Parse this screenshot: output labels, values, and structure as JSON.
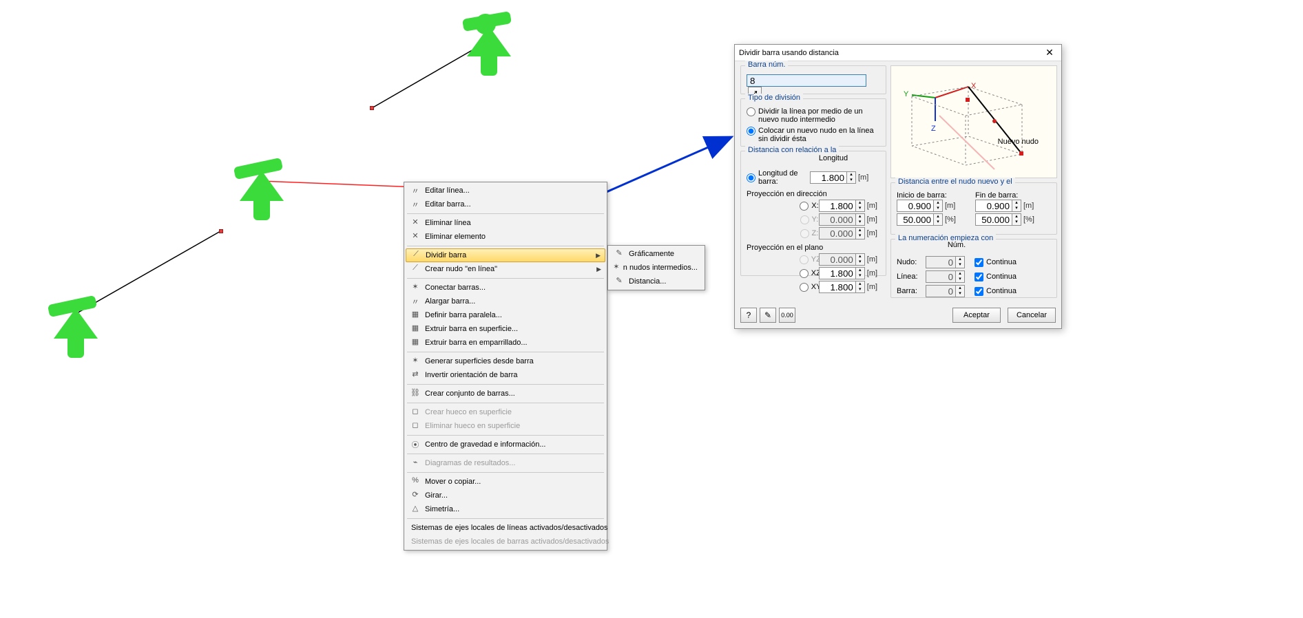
{
  "context_menu": {
    "items": [
      {
        "label": "Editar línea...",
        "sub": false,
        "disabled": false,
        "icon": "〃"
      },
      {
        "label": "Editar barra...",
        "sub": false,
        "disabled": false,
        "icon": "〃"
      },
      {
        "sep": true
      },
      {
        "label": "Eliminar línea",
        "sub": false,
        "disabled": false,
        "icon": "✕"
      },
      {
        "label": "Eliminar elemento",
        "sub": false,
        "disabled": false,
        "icon": "✕"
      },
      {
        "sep": true
      },
      {
        "label": "Dividir barra",
        "sub": true,
        "disabled": false,
        "highlight": true,
        "icon": "⟋"
      },
      {
        "label": "Crear nudo \"en línea\"",
        "sub": true,
        "disabled": false,
        "icon": "⟋"
      },
      {
        "sep": true
      },
      {
        "label": "Conectar barras...",
        "sub": false,
        "disabled": false,
        "icon": "✶"
      },
      {
        "label": "Alargar barra...",
        "sub": false,
        "disabled": false,
        "icon": "〃"
      },
      {
        "label": "Definir barra paralela...",
        "sub": false,
        "disabled": false,
        "icon": "▦"
      },
      {
        "label": "Extruir barra en superficie...",
        "sub": false,
        "disabled": false,
        "icon": "▦"
      },
      {
        "label": "Extruir barra en emparrillado...",
        "sub": false,
        "disabled": false,
        "icon": "▦"
      },
      {
        "sep": true
      },
      {
        "label": "Generar superficies desde barra",
        "sub": false,
        "disabled": false,
        "icon": "✶"
      },
      {
        "label": "Invertir orientación de barra",
        "sub": false,
        "disabled": false,
        "icon": "⇄"
      },
      {
        "sep": true
      },
      {
        "label": "Crear conjunto de barras...",
        "sub": false,
        "disabled": false,
        "icon": "⛓"
      },
      {
        "sep": true
      },
      {
        "label": "Crear hueco en superficie",
        "sub": false,
        "disabled": true,
        "icon": "◻"
      },
      {
        "label": "Eliminar hueco en superficie",
        "sub": false,
        "disabled": true,
        "icon": "◻"
      },
      {
        "sep": true
      },
      {
        "label": "Centro de gravedad e información...",
        "sub": false,
        "disabled": false,
        "icon": "⦿"
      },
      {
        "sep": true
      },
      {
        "label": "Diagramas de resultados...",
        "sub": false,
        "disabled": true,
        "icon": "⌁"
      },
      {
        "sep": true
      },
      {
        "label": "Mover o copiar...",
        "sub": false,
        "disabled": false,
        "icon": "%"
      },
      {
        "label": "Girar...",
        "sub": false,
        "disabled": false,
        "icon": "⟳"
      },
      {
        "label": "Simetría...",
        "sub": false,
        "disabled": false,
        "icon": "△"
      },
      {
        "sep": true
      },
      {
        "label": "Sistemas de ejes locales de líneas activados/desactivados",
        "sub": false,
        "disabled": false,
        "icon": ""
      },
      {
        "label": "Sistemas de ejes locales de barras activados/desactivados",
        "sub": false,
        "disabled": true,
        "icon": ""
      }
    ],
    "submenu": [
      {
        "label": "Gráficamente",
        "icon": "✎"
      },
      {
        "label": "n nudos intermedios...",
        "icon": "✶"
      },
      {
        "label": "Distancia...",
        "icon": "✎"
      }
    ]
  },
  "dialog": {
    "title": "Dividir barra usando distancia",
    "groups": {
      "barra_num": "Barra núm.",
      "tipo": "Tipo de división",
      "distancia_rel": "Distancia con relación a la",
      "distancia_nuevo": "Distancia entre el nudo nuevo y el",
      "numeracion": "La numeración empieza con"
    },
    "barra_value": "8",
    "tipo_opts": {
      "opt1": "Dividir la línea por medio de un nuevo nudo intermedio",
      "opt2": "Colocar un nuevo nudo en la línea sin dividir ésta"
    },
    "dist_rel": {
      "longitud_barra_label": "Longitud de barra:",
      "longitud_heading": "Longitud",
      "longitud": "1.800",
      "long_unit": "[m]",
      "proy_dir_label": "Proyección en dirección",
      "X_label": "X:",
      "X": "1.800",
      "X_unit": "[m]",
      "Y_label": "Y:",
      "Y": "0.000",
      "Y_unit": "[m]",
      "Z_label": "Z:",
      "Z": "0.000",
      "Z_unit": "[m]",
      "proy_plano_label": "Proyección en el plano",
      "YZ_label": "YZ:",
      "YZ": "0.000",
      "YZ_unit": "[m]",
      "XZ_label": "XZ:",
      "XZ": "1.800",
      "XZ_unit": "[m]",
      "XY_label": "XY:",
      "XY": "1.800",
      "XY_unit": "[m]"
    },
    "dist_new": {
      "inicio_label": "Inicio de barra:",
      "fin_label": "Fin de barra:",
      "inicio_m": "0.900",
      "fin_m": "0.900",
      "unit_m": "[m]",
      "inicio_pct": "50.000",
      "fin_pct": "50.000",
      "unit_pct": "[%]"
    },
    "numeracion": {
      "num_heading": "Núm.",
      "nudo_label": "Nudo:",
      "nudo": "0",
      "nudo_chk": "Continua",
      "linea_label": "Línea:",
      "linea": "0",
      "linea_chk": "Continua",
      "barra_label": "Barra:",
      "barra": "0",
      "barra_chk": "Continua"
    },
    "preview_label": "Nuevo nudo",
    "axis": {
      "X": "X",
      "Y": "Y",
      "Z": "Z"
    },
    "buttons": {
      "ok": "Aceptar",
      "cancel": "Cancelar"
    }
  }
}
